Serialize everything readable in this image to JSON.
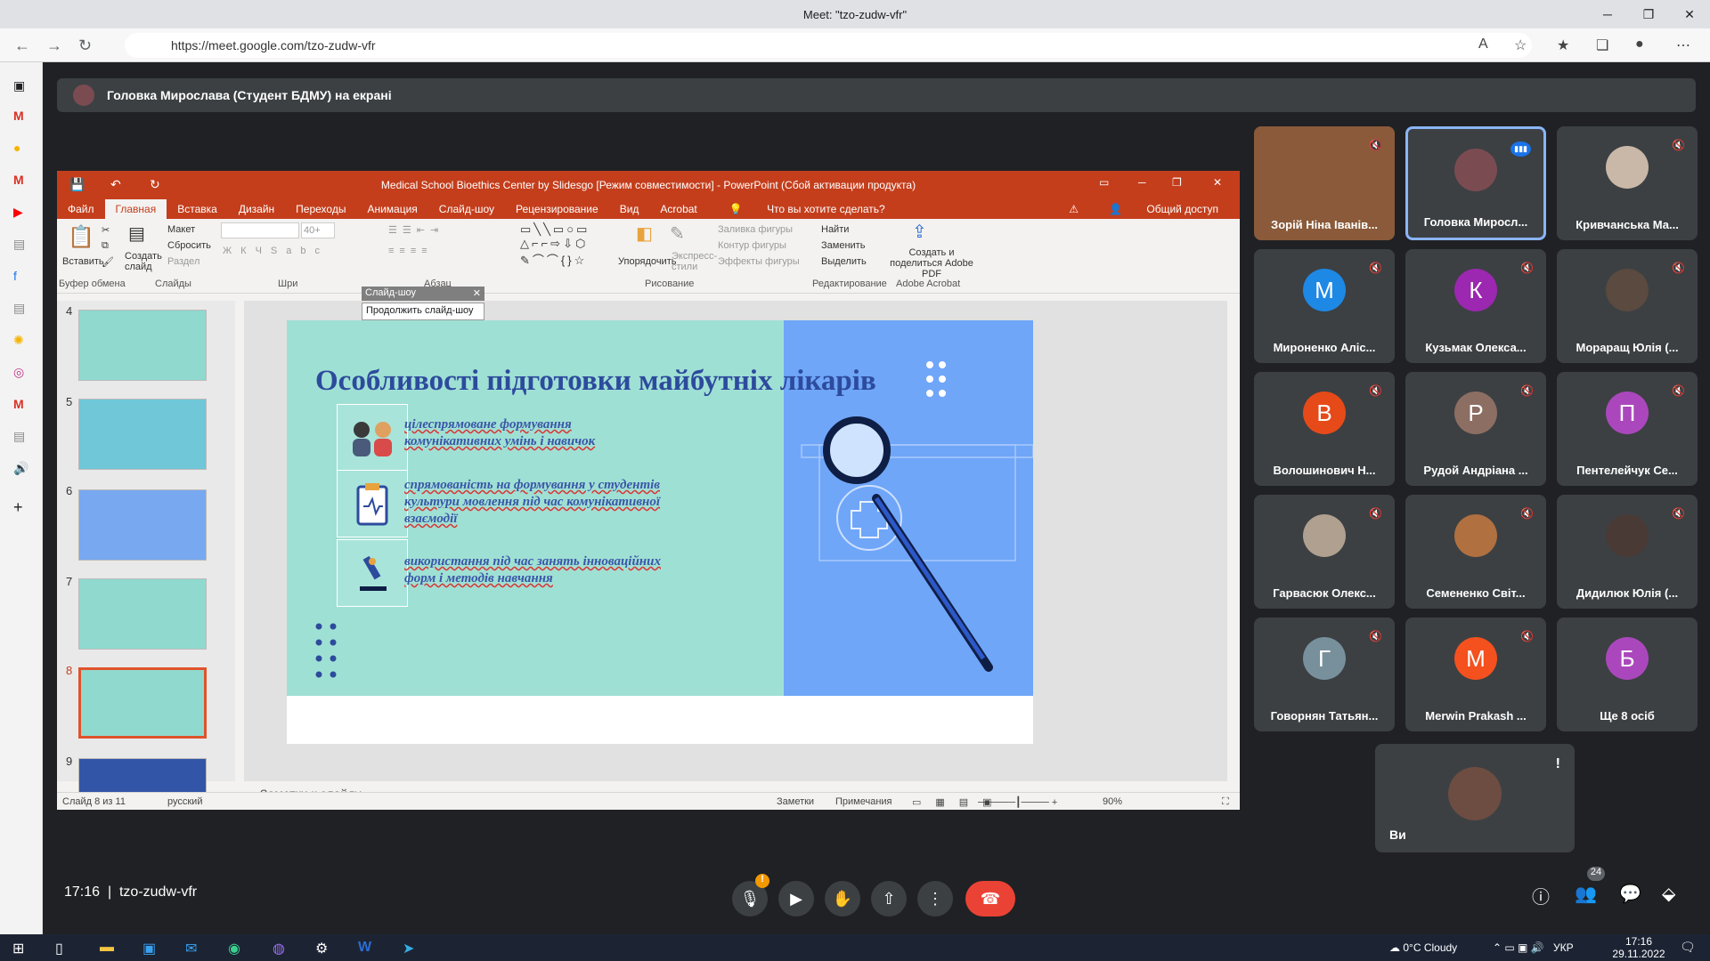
{
  "browser": {
    "tab_title": "Meet: \"tzo-zudw-vfr\"",
    "url": "https://meet.google.com/tzo-zudw-vfr"
  },
  "meet": {
    "presenting_banner": "Головка Мирослава (Студент БДМУ) на екрані",
    "time": "17:16",
    "meeting_code": "tzo-zudw-vfr",
    "participants_count": "24",
    "participants": [
      {
        "name": "Зорій Ніна Іванів...",
        "initial": "",
        "color": "#8a5a3a"
      },
      {
        "name": "Головка Миросл...",
        "initial": "",
        "color": "#7b4b52"
      },
      {
        "name": "Кривчанська Ма...",
        "initial": "",
        "color": "#c9b8a8"
      },
      {
        "name": "Мироненко Аліс...",
        "initial": "М",
        "color": "#1e88e5"
      },
      {
        "name": "Кузьмак Олекса...",
        "initial": "К",
        "color": "#9c27b0"
      },
      {
        "name": "Мораращ Юлія (...",
        "initial": "",
        "color": "#5a4a3f"
      },
      {
        "name": "Волошинович Н...",
        "initial": "В",
        "color": "#e64a19"
      },
      {
        "name": "Рудой Андріана ...",
        "initial": "Р",
        "color": "#8d6e63"
      },
      {
        "name": "Пентелейчук Се...",
        "initial": "П",
        "color": "#ab47bc"
      },
      {
        "name": "Гарвасюк Олекс...",
        "initial": "",
        "color": "#b0a090"
      },
      {
        "name": "Семененко Світ...",
        "initial": "",
        "color": "#b07040"
      },
      {
        "name": "Дидилюк Юлія (...",
        "initial": "",
        "color": "#4a3a35"
      },
      {
        "name": "Говорнян Татьян...",
        "initial": "Г",
        "color": "#78909c"
      },
      {
        "name": "Merwin Prakash ...",
        "initial": "M",
        "color": "#f4511e"
      },
      {
        "name": "Ще 8 осіб",
        "initial": "Б",
        "color": "#ab47bc"
      }
    ],
    "self_label": "Ви"
  },
  "ppt": {
    "window_title": "Medical School Bioethics Center by Slidesgo [Режим совместимости] - PowerPoint (Сбой активации продукта)",
    "tabs": [
      "Файл",
      "Главная",
      "Вставка",
      "Дизайн",
      "Переходы",
      "Анимация",
      "Слайд-шоу",
      "Рецензирование",
      "Вид",
      "Acrobat"
    ],
    "tell_me": "Что вы хотите сделать?",
    "share": "Общий доступ",
    "ribbon": {
      "paste": "Вставить",
      "clipboard": "Буфер обмена",
      "new_slide": "Создать слайд",
      "layout": "Макет",
      "reset": "Сбросить",
      "section": "Раздел",
      "slides_group": "Слайды",
      "font_group": "Шри",
      "paragraph_group": "Абзац",
      "arrange": "Упорядочить",
      "quick_styles": "Экспресс-стили",
      "shape_fill": "Заливка фигуры",
      "shape_outline": "Контур фигуры",
      "shape_effects": "Эффекты фигуры",
      "drawing_group": "Рисование",
      "find": "Найти",
      "replace": "Заменить",
      "select": "Выделить",
      "editing_group": "Редактирование",
      "acrobat_btn": "Создать и поделиться Adobe PDF",
      "acrobat_group": "Adobe Acrobat",
      "font_size": "40+"
    },
    "slideshow_toolbar": "Слайд-шоу",
    "continue_slideshow": "Продолжить слайд-шоу",
    "slide_numbers": [
      "4",
      "5",
      "6",
      "7",
      "8",
      "9"
    ],
    "slide": {
      "title": "Особливості підготовки майбутніх лікарів",
      "bullets": [
        "цілеспрямоване формування комунікативних умінь і навичок",
        "спрямованість на формування у студентів культури мовлення під час комунікативної взаємодії",
        "використання під час занять інноваційних форм і методів навчання"
      ]
    },
    "notes_placeholder": "Заметки к слайду",
    "status": {
      "slide_of": "Слайд 8 из 11",
      "language": "русский",
      "notes": "Заметки",
      "comments": "Примечания",
      "zoom": "90%"
    }
  },
  "taskbar": {
    "weather": "0°C  Cloudy",
    "lang": "УКР",
    "time": "17:16",
    "date": "29.11.2022"
  }
}
